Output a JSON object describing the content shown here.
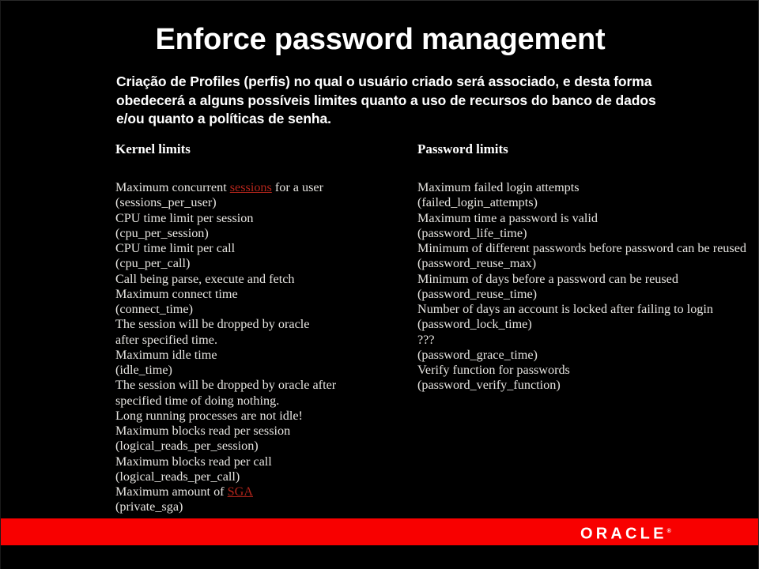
{
  "slide": {
    "title": "Enforce password management",
    "subtitle": "Criação de Profiles (perfis) no qual o usuário criado será associado, e desta forma obedecerá a alguns possíveis limites quanto a uso de recursos do banco de dados e/ou quanto a políticas de senha.",
    "background_color": "#000000",
    "text_color": "#e6e4e0",
    "accent_color": "#f80000",
    "link_color": "#b2251b"
  },
  "left_column": {
    "heading": "Kernel limits",
    "lines": [
      {
        "parts": [
          {
            "text": "Maximum concurrent "
          },
          {
            "text": "sessions",
            "link": true
          },
          {
            "text": " for a user"
          }
        ]
      },
      {
        "parts": [
          {
            "text": "(sessions_per_user)"
          }
        ]
      },
      {
        "parts": [
          {
            "text": "CPU time limit per session"
          }
        ]
      },
      {
        "parts": [
          {
            "text": "(cpu_per_session)"
          }
        ]
      },
      {
        "parts": [
          {
            "text": "CPU time limit per call"
          }
        ]
      },
      {
        "parts": [
          {
            "text": "(cpu_per_call)"
          }
        ]
      },
      {
        "parts": [
          {
            "text": "Call being parse, execute and fetch"
          }
        ]
      },
      {
        "parts": [
          {
            "text": "Maximum connect time"
          }
        ]
      },
      {
        "parts": [
          {
            "text": "(connect_time)"
          }
        ]
      },
      {
        "parts": [
          {
            "text": "The session will be dropped by oracle"
          }
        ]
      },
      {
        "parts": [
          {
            "text": "after specified time."
          }
        ]
      },
      {
        "parts": [
          {
            "text": "Maximum idle time"
          }
        ]
      },
      {
        "parts": [
          {
            "text": "(idle_time)"
          }
        ]
      },
      {
        "parts": [
          {
            "text": "The session will be dropped by oracle after"
          }
        ]
      },
      {
        "parts": [
          {
            "text": "specified time of doing nothing."
          }
        ]
      },
      {
        "parts": [
          {
            "text": "Long running processes are not idle!"
          }
        ]
      },
      {
        "parts": [
          {
            "text": "Maximum blocks read per session"
          }
        ]
      },
      {
        "parts": [
          {
            "text": "(logical_reads_per_session)"
          }
        ]
      },
      {
        "parts": [
          {
            "text": "Maximum blocks read per call"
          }
        ]
      },
      {
        "parts": [
          {
            "text": "(logical_reads_per_call)"
          }
        ]
      },
      {
        "parts": [
          {
            "text": "Maximum amount of "
          },
          {
            "text": "SGA",
            "link": true
          }
        ]
      },
      {
        "parts": [
          {
            "text": "(private_sga)"
          }
        ]
      }
    ]
  },
  "right_column": {
    "heading": "Password limits",
    "lines": [
      {
        "parts": [
          {
            "text": "Maximum failed login attempts"
          }
        ]
      },
      {
        "parts": [
          {
            "text": "(failed_login_attempts)"
          }
        ]
      },
      {
        "parts": [
          {
            "text": "Maximum time a password is valid"
          }
        ]
      },
      {
        "parts": [
          {
            "text": "(password_life_time)"
          }
        ]
      },
      {
        "parts": [
          {
            "text": "Minimum of different passwords before password can be reused"
          }
        ]
      },
      {
        "parts": [
          {
            "text": "(password_reuse_max)"
          }
        ]
      },
      {
        "parts": [
          {
            "text": "Minimum of days before a password can be reused"
          }
        ]
      },
      {
        "parts": [
          {
            "text": "(password_reuse_time)"
          }
        ]
      },
      {
        "parts": [
          {
            "text": "Number of days an account is locked after failing to login"
          }
        ]
      },
      {
        "parts": [
          {
            "text": "(password_lock_time)"
          }
        ]
      },
      {
        "parts": [
          {
            "text": "???"
          }
        ]
      },
      {
        "parts": [
          {
            "text": "(password_grace_time)"
          }
        ]
      },
      {
        "parts": [
          {
            "text": "Verify function for passwords"
          }
        ]
      },
      {
        "parts": [
          {
            "text": "(password_verify_function)"
          }
        ]
      }
    ]
  },
  "footer": {
    "logo_text": "ORACLE",
    "logo_mark": "®",
    "band_color": "#f80000"
  }
}
